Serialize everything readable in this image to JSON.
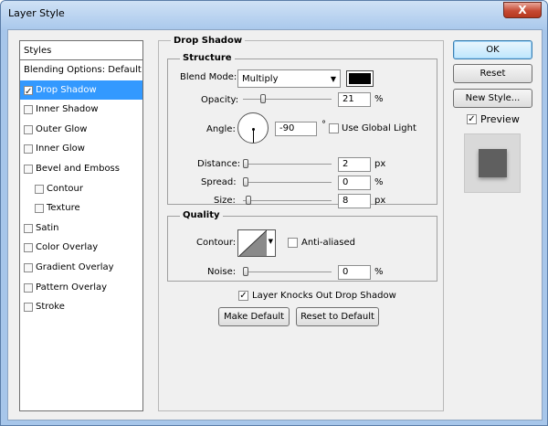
{
  "window": {
    "title": "Layer Style",
    "close_glyph": "X"
  },
  "style_list": {
    "header": "Styles",
    "items": [
      {
        "label": "Blending Options: Default",
        "checkbox": false,
        "checked": false,
        "selected": false,
        "indent": 0
      },
      {
        "label": "Drop Shadow",
        "checkbox": true,
        "checked": true,
        "selected": true,
        "indent": 0
      },
      {
        "label": "Inner Shadow",
        "checkbox": true,
        "checked": false,
        "selected": false,
        "indent": 0
      },
      {
        "label": "Outer Glow",
        "checkbox": true,
        "checked": false,
        "selected": false,
        "indent": 0
      },
      {
        "label": "Inner Glow",
        "checkbox": true,
        "checked": false,
        "selected": false,
        "indent": 0
      },
      {
        "label": "Bevel and Emboss",
        "checkbox": true,
        "checked": false,
        "selected": false,
        "indent": 0
      },
      {
        "label": "Contour",
        "checkbox": true,
        "checked": false,
        "selected": false,
        "indent": 1
      },
      {
        "label": "Texture",
        "checkbox": true,
        "checked": false,
        "selected": false,
        "indent": 1
      },
      {
        "label": "Satin",
        "checkbox": true,
        "checked": false,
        "selected": false,
        "indent": 0
      },
      {
        "label": "Color Overlay",
        "checkbox": true,
        "checked": false,
        "selected": false,
        "indent": 0
      },
      {
        "label": "Gradient Overlay",
        "checkbox": true,
        "checked": false,
        "selected": false,
        "indent": 0
      },
      {
        "label": "Pattern Overlay",
        "checkbox": true,
        "checked": false,
        "selected": false,
        "indent": 0
      },
      {
        "label": "Stroke",
        "checkbox": true,
        "checked": false,
        "selected": false,
        "indent": 0
      }
    ]
  },
  "panel": {
    "title": "Drop Shadow",
    "structure": {
      "title": "Structure",
      "blend_mode_label": "Blend Mode:",
      "blend_mode_value": "Multiply",
      "shadow_color": "#000000",
      "opacity_label": "Opacity:",
      "opacity_value": "21",
      "opacity_unit": "%",
      "angle_label": "Angle:",
      "angle_value": "-90",
      "angle_unit": "°",
      "global_light_label": "Use Global Light",
      "global_light_checked": false,
      "distance_label": "Distance:",
      "distance_value": "2",
      "distance_unit": "px",
      "spread_label": "Spread:",
      "spread_value": "0",
      "spread_unit": "%",
      "size_label": "Size:",
      "size_value": "8",
      "size_unit": "px"
    },
    "quality": {
      "title": "Quality",
      "contour_label": "Contour:",
      "anti_aliased_label": "Anti-aliased",
      "anti_aliased_checked": false,
      "noise_label": "Noise:",
      "noise_value": "0",
      "noise_unit": "%"
    },
    "knockout_label": "Layer Knocks Out Drop Shadow",
    "knockout_checked": true,
    "make_default_label": "Make Default",
    "reset_default_label": "Reset to Default"
  },
  "actions": {
    "ok_label": "OK",
    "reset_label": "Reset",
    "new_style_label": "New Style...",
    "preview_label": "Preview",
    "preview_checked": true
  },
  "colors": {
    "selection": "#3399ff",
    "window_frame": "#a7c6ea",
    "dialog_bg": "#f0f0f0"
  }
}
